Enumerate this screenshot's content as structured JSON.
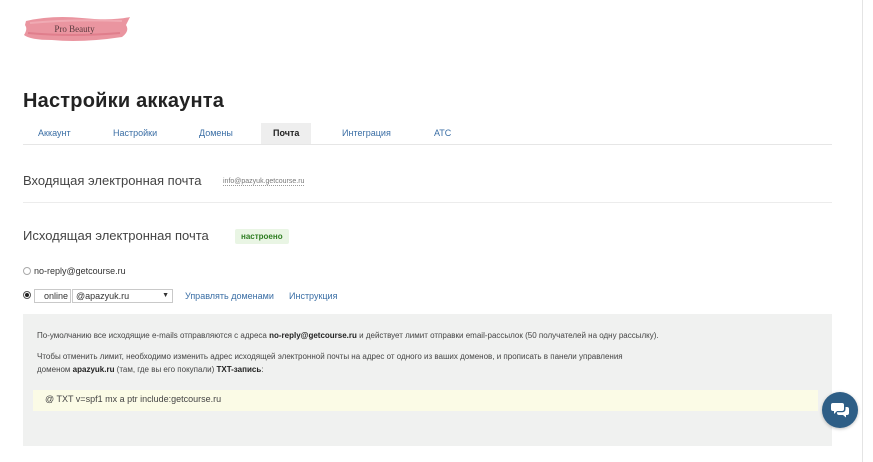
{
  "logo": {
    "text": "Pro Beauty",
    "color": "#e88a96"
  },
  "page": {
    "title": "Настройки аккаунта"
  },
  "tabs": [
    {
      "label": "Аккаунт",
      "active": false
    },
    {
      "label": "Настройки",
      "active": false
    },
    {
      "label": "Домены",
      "active": false
    },
    {
      "label": "Почта",
      "active": true
    },
    {
      "label": "Интеграция",
      "active": false
    },
    {
      "label": "АТС",
      "active": false
    }
  ],
  "incoming": {
    "title": "Входящая электронная почта",
    "email": "info@pazyuk.getcourse.ru"
  },
  "outgoing": {
    "title": "Исходящая электронная почта",
    "status_badge": "настроено",
    "option_default": {
      "label": "no-reply@getcourse.ru",
      "selected": false
    },
    "option_custom": {
      "selected": true,
      "local_part_value": "online",
      "domain_value": "@apazyuk.ru"
    },
    "manage_domains_link": "Управлять доменами",
    "instructions_link": "Инструкция"
  },
  "info": {
    "p1_prefix": "По-умолчанию все исходящие e-mails отправляются с адреса ",
    "p1_email": "no-reply@getcourse.ru",
    "p1_suffix": " и действует лимит отправки email-рассылок (50 получателей на одну рассылку).",
    "p2_line1": "Чтобы отменить лимит, необходимо изменить адрес исходящей электронной почты на адрес от одного из ваших доменов, и прописать в панели управления",
    "p2_prefix": "доменом ",
    "p2_domain": "apazyuk.ru",
    "p2_middle": " (там, где вы его покупали) ",
    "p2_record": "TXT-запись",
    "p2_suffix": ":",
    "txt_record": "@ TXT v=spf1 mx a ptr include:getcourse.ru"
  },
  "colors": {
    "link": "#3a6ea5",
    "badge_bg": "#e9f5e4",
    "badge_text": "#2e7d22",
    "chat_button": "#2e5e86",
    "info_bg": "#f0f1f0",
    "code_bg": "#fbfbe6"
  },
  "icons": {
    "chat": "chat-bubbles-icon",
    "select_arrow": "triangle-down"
  }
}
